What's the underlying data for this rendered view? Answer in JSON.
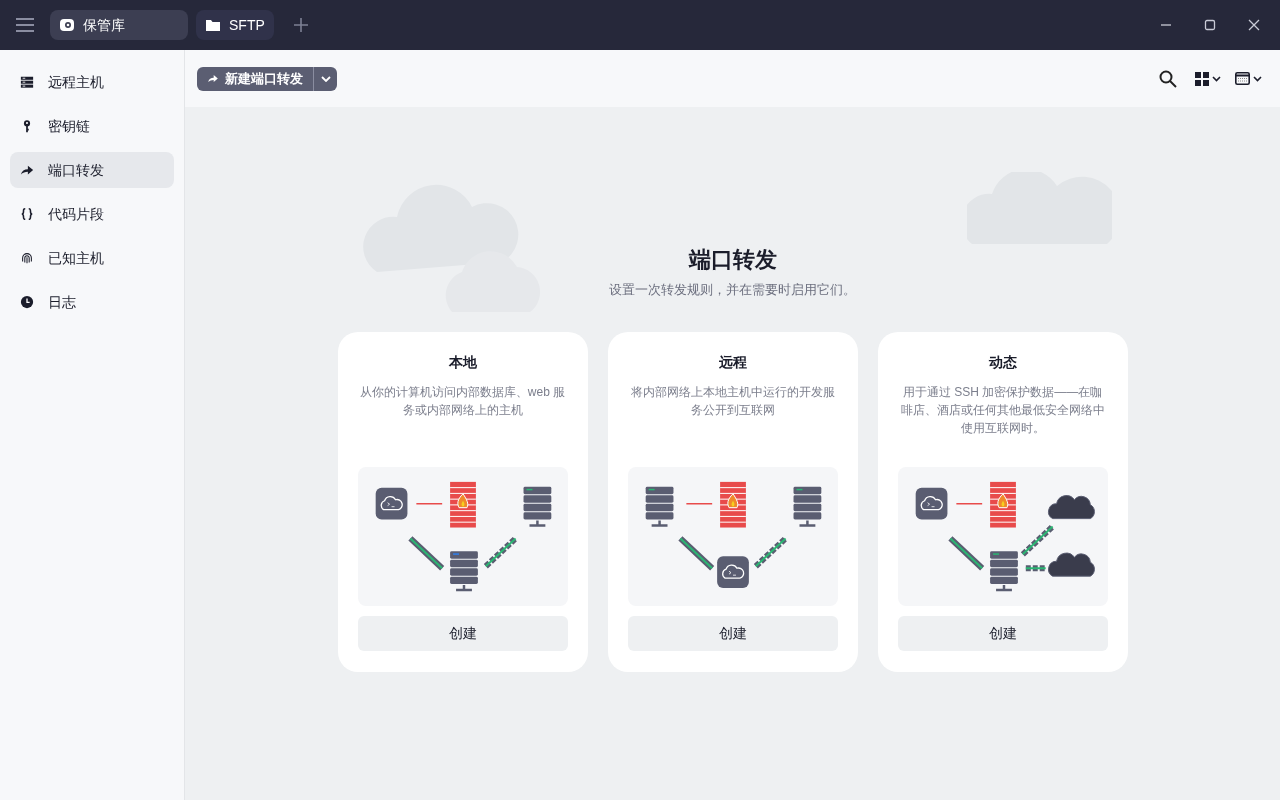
{
  "titlebar": {
    "tabs": [
      {
        "label": "保管库",
        "selected": true
      },
      {
        "label": "SFTP",
        "selected": false
      }
    ]
  },
  "sidebar": {
    "items": [
      {
        "label": "远程主机",
        "selected": false
      },
      {
        "label": "密钥链",
        "selected": false
      },
      {
        "label": "端口转发",
        "selected": true
      },
      {
        "label": "代码片段",
        "selected": false
      },
      {
        "label": "已知主机",
        "selected": false
      },
      {
        "label": "日志",
        "selected": false
      }
    ]
  },
  "toolbar": {
    "new_button": "新建端口转发"
  },
  "main": {
    "title": "端口转发",
    "subtitle": "设置一次转发规则，并在需要时启用它们。",
    "cards": [
      {
        "title": "本地",
        "description": "从你的计算机访问内部数据库、web 服务或内部网络上的主机",
        "button": "创建"
      },
      {
        "title": "远程",
        "description": "将内部网络上本地主机中运行的开发服务公开到互联网",
        "button": "创建"
      },
      {
        "title": "动态",
        "description": "用于通过 SSH 加密保护数据——在咖啡店、酒店或任何其他最低安全网络中使用互联网时。",
        "button": "创建"
      }
    ]
  }
}
